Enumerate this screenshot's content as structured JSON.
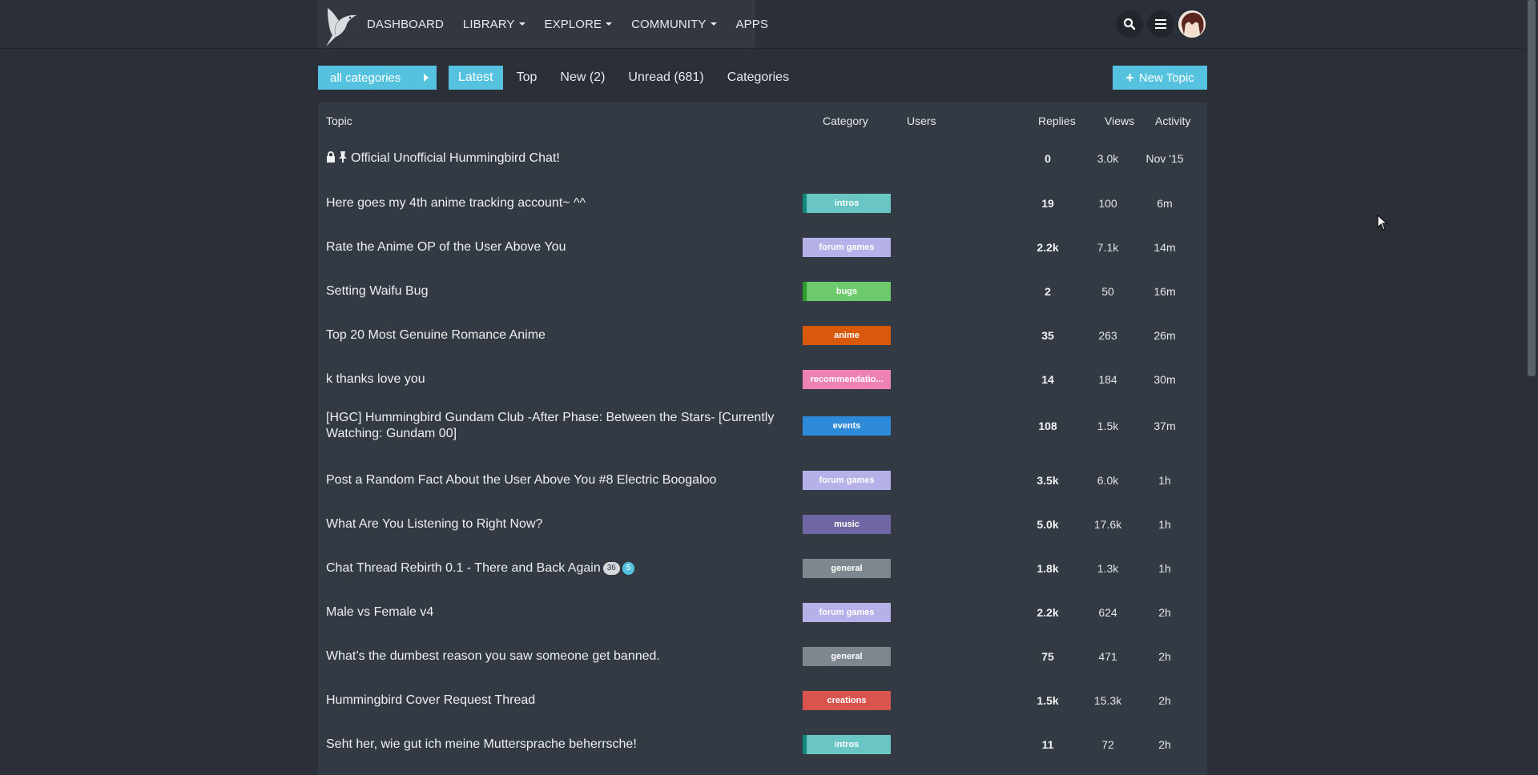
{
  "nav": {
    "links": [
      {
        "label": "DASHBOARD",
        "caret": false
      },
      {
        "label": "LIBRARY",
        "caret": true
      },
      {
        "label": "EXPLORE",
        "caret": true
      },
      {
        "label": "COMMUNITY",
        "caret": true
      },
      {
        "label": "APPS",
        "caret": false
      }
    ],
    "icons": [
      "search-icon",
      "menu-icon",
      "avatar"
    ]
  },
  "filter": {
    "all_categories": "all categories",
    "tabs": [
      "Latest",
      "Top",
      "New (2)",
      "Unread (681)",
      "Categories"
    ],
    "active_tab": "Latest",
    "new_topic": "New Topic"
  },
  "table": {
    "headers": {
      "topic": "Topic",
      "category": "Category",
      "users": "Users",
      "replies": "Replies",
      "views": "Views",
      "activity": "Activity"
    },
    "rows": [
      {
        "title": "Official Unofficial Hummingbird Chat!",
        "locked": true,
        "pinned": true,
        "category": "",
        "replies": "0",
        "views": "3.0k",
        "activity": "Nov '15"
      },
      {
        "title": "Here goes my 4th anime tracking account~ ^^",
        "category": "intros",
        "color": "#6ac6c5",
        "stripe": "#13857a",
        "replies": "19",
        "views": "100",
        "activity": "6m"
      },
      {
        "title": "Rate the Anime OP of the User Above You",
        "category": "forum games",
        "color": "#b6b1e8",
        "stripe": "#b6b1e8",
        "replies": "2.2k",
        "views": "7.1k",
        "activity": "14m"
      },
      {
        "title": "Setting Waifu Bug",
        "category": "bugs",
        "color": "#6cc96c",
        "stripe": "#2c9a2c",
        "replies": "2",
        "views": "50",
        "activity": "16m"
      },
      {
        "title": "Top 20 Most Genuine Romance Anime",
        "category": "anime",
        "color": "#d9590c",
        "stripe": "#d9590c",
        "replies": "35",
        "views": "263",
        "activity": "26m"
      },
      {
        "title": "k thanks love you",
        "category": "recommendatio...",
        "color": "#ef82b4",
        "stripe": "#ef82b4",
        "replies": "14",
        "views": "184",
        "activity": "30m"
      },
      {
        "title": "[HGC] Hummingbird Gundam Club -After Phase: Between the Stars- [Currently Watching: Gundam 00]",
        "category": "events",
        "color": "#2d8ad9",
        "stripe": "#2d8ad9",
        "replies": "108",
        "views": "1.5k",
        "activity": "37m"
      },
      {
        "title": "Post a Random Fact About the User Above You #8 Electric Boogaloo",
        "category": "forum games",
        "color": "#b6b1e8",
        "stripe": "#b6b1e8",
        "replies": "3.5k",
        "views": "6.0k",
        "activity": "1h"
      },
      {
        "title": "What Are You Listening to Right Now?",
        "category": "music",
        "color": "#6e67a3",
        "stripe": "#6e67a3",
        "replies": "5.0k",
        "views": "17.6k",
        "activity": "1h"
      },
      {
        "title": "Chat Thread Rebirth 0.1 - There and Back Again",
        "pill1": "36",
        "pill2": "5",
        "category": "general",
        "color": "#7e878e",
        "stripe": "#7e878e",
        "replies": "1.8k",
        "views": "1.3k",
        "activity": "1h"
      },
      {
        "title": "Male vs Female v4",
        "category": "forum games",
        "color": "#b6b1e8",
        "stripe": "#b6b1e8",
        "replies": "2.2k",
        "views": "624",
        "activity": "2h"
      },
      {
        "title": "What’s the dumbest reason you saw someone get banned.",
        "category": "general",
        "color": "#7e878e",
        "stripe": "#7e878e",
        "replies": "75",
        "views": "471",
        "activity": "2h"
      },
      {
        "title": "Hummingbird Cover Request Thread",
        "category": "creations",
        "color": "#d9544f",
        "stripe": "#d9544f",
        "replies": "1.5k",
        "views": "15.3k",
        "activity": "2h"
      },
      {
        "title": "Seht her, wie gut ich meine Muttersprache beherrsche!",
        "category": "intros",
        "color": "#6ac6c5",
        "stripe": "#13857a",
        "replies": "11",
        "views": "72",
        "activity": "2h"
      }
    ]
  }
}
